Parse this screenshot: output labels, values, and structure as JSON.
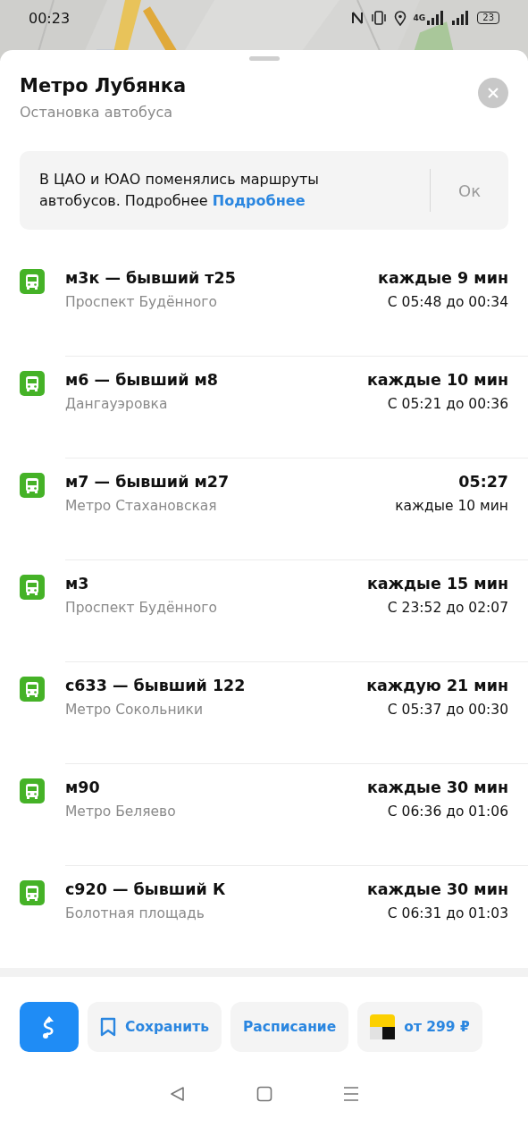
{
  "status_bar": {
    "time": "00:23",
    "network": "4G",
    "battery": "23"
  },
  "stop": {
    "title": "Метро Лубянка",
    "subtitle": "Остановка автобуса"
  },
  "notice": {
    "text": "В ЦАО и ЮАО поменялись маршруты автобусов. Подробнее",
    "link": "Подробнее",
    "button": "Ок"
  },
  "routes": [
    {
      "name": "м3к — бывший т25",
      "destination": "Проспект Будённого",
      "primary": "каждые 9 мин",
      "secondary": "С 05:48 до 00:34"
    },
    {
      "name": "м6 — бывший м8",
      "destination": "Дангауэровка",
      "primary": "каждые 10 мин",
      "secondary": "С 05:21 до 00:36"
    },
    {
      "name": "м7 — бывший м27",
      "destination": "Метро Стахановская",
      "primary": "05:27",
      "secondary": "каждые 10 мин"
    },
    {
      "name": "м3",
      "destination": "Проспект Будённого",
      "primary": "каждые 15 мин",
      "secondary": "С 23:52 до 02:07"
    },
    {
      "name": "с633 — бывший 122",
      "destination": "Метро Сокольники",
      "primary": "каждую 21 мин",
      "secondary": "С 05:37 до 00:30"
    },
    {
      "name": "м90",
      "destination": "Метро Беляево",
      "primary": "каждые 30 мин",
      "secondary": "С 06:36 до 01:06"
    },
    {
      "name": "с920 — бывший К",
      "destination": "Болотная площадь",
      "primary": "каждые 30 мин",
      "secondary": "С 06:31 до 01:03"
    }
  ],
  "actions": {
    "save": "Сохранить",
    "schedule": "Расписание",
    "taxi": "от 299 ₽"
  }
}
